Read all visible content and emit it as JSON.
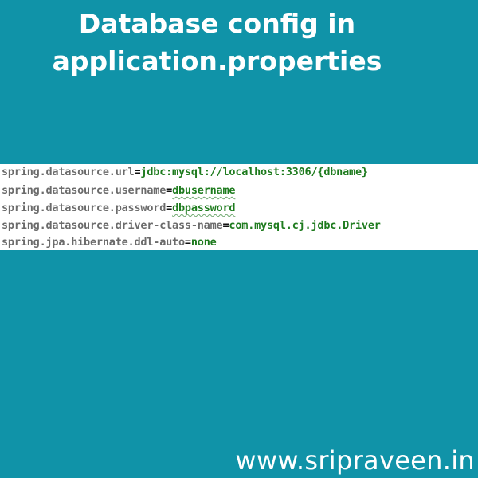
{
  "header": {
    "title_line1": "Database config in",
    "title_line2": "application.properties"
  },
  "code": {
    "lines": [
      {
        "key": "spring.datasource.url",
        "eq": "=",
        "value": "jdbc:mysql://localhost:3306/{dbname}"
      },
      {
        "key": "spring.datasource.username",
        "eq": "=",
        "value": "dbusername"
      },
      {
        "key": "spring.datasource.password",
        "eq": "=",
        "value": "dbpassword"
      },
      {
        "key": "spring.datasource.driver-class-name",
        "eq": "=",
        "value": "com.mysql.cj.jdbc.Driver"
      },
      {
        "key": "spring.jpa.hibernate.ddl-auto",
        "eq": "=",
        "value": "none"
      }
    ]
  },
  "footer": {
    "website": "www.sripraveen.in"
  },
  "colors": {
    "background": "#1093a8",
    "code_key": "#6b6b6b",
    "code_value": "#1e7b1e",
    "text_white": "#ffffff"
  }
}
